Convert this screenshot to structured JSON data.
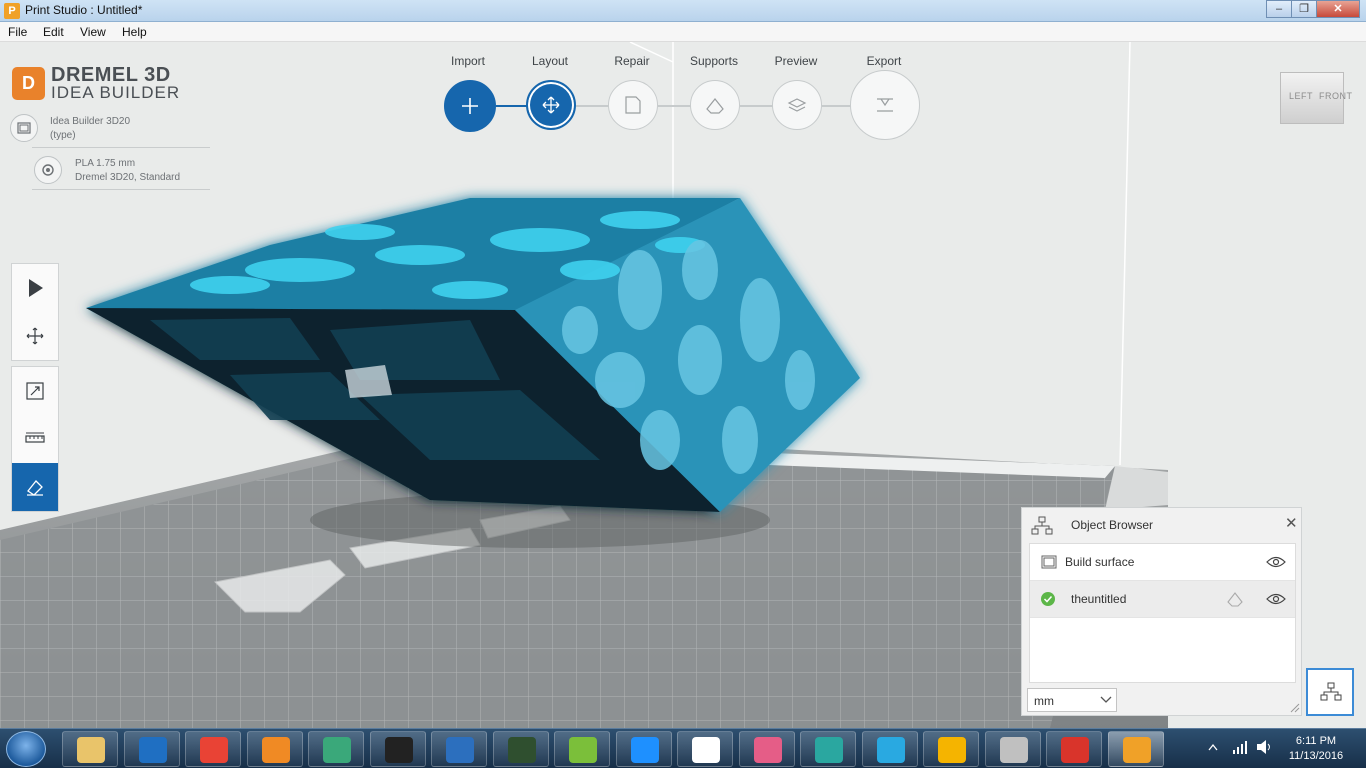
{
  "window": {
    "title": "Print Studio : Untitled*",
    "app_icon": "P",
    "minimize_icon": "minimize-icon",
    "maximize_icon": "maximize-icon",
    "close_icon": "close-icon"
  },
  "menu": [
    "File",
    "Edit",
    "View",
    "Help"
  ],
  "brand": {
    "mark": "D",
    "line1": "DREMEL 3D",
    "line2": "IDEA BUILDER"
  },
  "printer": {
    "model": "Idea Builder 3D20",
    "model_sub": "(type)",
    "material": "PLA 1.75 mm",
    "profile": "Dremel 3D20, Standard"
  },
  "workflow": {
    "steps": [
      {
        "label": "Import",
        "icon": "plus-icon",
        "state": "done"
      },
      {
        "label": "Layout",
        "icon": "move-icon",
        "state": "current"
      },
      {
        "label": "Repair",
        "icon": "page-icon",
        "state": "pending"
      },
      {
        "label": "Supports",
        "icon": "support-icon",
        "state": "pending"
      },
      {
        "label": "Preview",
        "icon": "layers-icon",
        "state": "pending"
      },
      {
        "label": "Export",
        "icon": "export-icon",
        "state": "pending"
      }
    ]
  },
  "view_cube": {
    "left": "LEFT",
    "front": "FRONT"
  },
  "tools": {
    "group1": [
      "select-arrow-icon",
      "move-icon"
    ],
    "group2": [
      "scale-icon",
      "measure-ruler-icon",
      "lay-flat-icon"
    ],
    "selected": "lay-flat-icon"
  },
  "object_browser": {
    "title": "Object Browser",
    "close": "✕",
    "rows": [
      {
        "label": "Build surface",
        "icon": "build-surface-icon",
        "visible": true
      },
      {
        "label": "theuntitled",
        "icon": "check-icon",
        "visible": true,
        "selected": true
      }
    ],
    "unit": "mm"
  },
  "taskbar": {
    "apps": [
      "file-explorer-icon",
      "outlook-icon",
      "chrome-icon",
      "firefox-icon",
      "connect-icon",
      "cmd-icon",
      "typing-icon",
      "terminal-icon",
      "hs-icon",
      "video-player-icon",
      "vnc-icon",
      "diamond-app-icon",
      "tree-app-icon",
      "ki-icon",
      "circle-app-icon",
      "paint-icon",
      "sketchup-icon",
      "print-studio-icon"
    ],
    "time": "6:11 PM",
    "date": "11/13/2016"
  },
  "colors": {
    "accent": "#1666ad",
    "brand_orange": "#e9822b",
    "model_cyan": "#31c6e6"
  }
}
